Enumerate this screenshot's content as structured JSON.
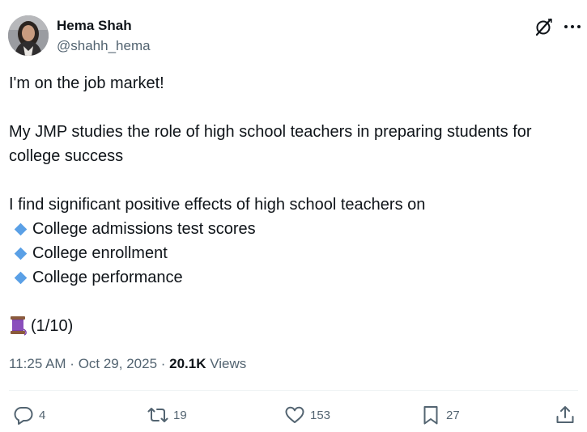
{
  "author": {
    "name": "Hema Shah",
    "handle": "@shahh_hema"
  },
  "post": {
    "line1": "I'm on the job market!",
    "line2": "My JMP studies the role of high school teachers in preparing students for",
    "line3": "college success",
    "line4": "I find significant positive effects of high school teachers on",
    "bullets": [
      "College admissions test scores",
      "College enrollment",
      "College performance"
    ],
    "thread_marker": "(1/10)"
  },
  "meta": {
    "time": "11:25 AM",
    "sep1": " · ",
    "date": "Oct 29, 2025",
    "sep2": " · ",
    "views_count": "20.1K",
    "views_label": " Views"
  },
  "actions": {
    "replies": "4",
    "reposts": "19",
    "likes": "153",
    "bookmarks": "27"
  },
  "icons": {
    "grok": "grok-icon",
    "more": "more-icon",
    "reply": "reply-icon",
    "repost": "repost-icon",
    "like": "heart-icon",
    "bookmark": "bookmark-icon",
    "share": "share-icon",
    "thread": "spool-of-thread-icon"
  },
  "colors": {
    "text": "#0f1419",
    "secondary": "#536471",
    "bullet": "#5aa0e6",
    "divider": "#eff3f4"
  }
}
